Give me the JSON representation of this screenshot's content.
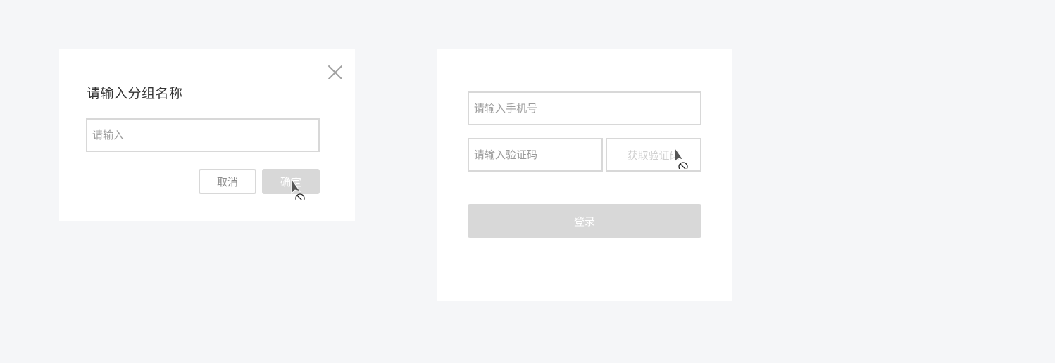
{
  "group_dialog": {
    "title": "请输入分组名称",
    "name_input": {
      "placeholder": "请输入",
      "value": ""
    },
    "cancel_label": "取消",
    "confirm_label": "确定",
    "confirm_state": "disabled"
  },
  "login_form": {
    "phone_input": {
      "placeholder": "请输入手机号",
      "value": ""
    },
    "code_input": {
      "placeholder": "请输入验证码",
      "value": ""
    },
    "get_code_label": "获取验证码",
    "get_code_state": "disabled",
    "login_label": "登录",
    "login_state": "disabled"
  },
  "icons": {
    "close": "close-icon",
    "cursor": "not-allowed-cursor-icon"
  },
  "colors": {
    "background": "#f5f6f8",
    "card": "#ffffff",
    "border": "#d8d8d8",
    "disabled_button": "#d8d8d8",
    "title_text": "#333333",
    "placeholder_text": "#9b9b9b"
  }
}
